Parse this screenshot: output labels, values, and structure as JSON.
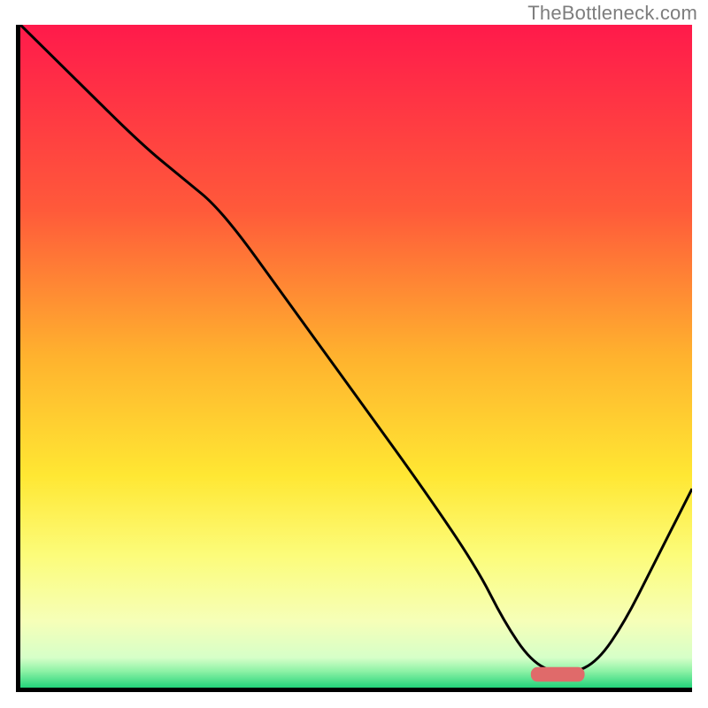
{
  "watermark": {
    "text": "TheBottleneck.com"
  },
  "chart_data": {
    "type": "line",
    "title": "",
    "xlabel": "",
    "ylabel": "",
    "xlim": [
      0,
      100
    ],
    "ylim": [
      0,
      100
    ],
    "gradient_stops": [
      {
        "offset": 0,
        "color": "#ff1a4b"
      },
      {
        "offset": 0.28,
        "color": "#ff5a3a"
      },
      {
        "offset": 0.5,
        "color": "#ffb22e"
      },
      {
        "offset": 0.68,
        "color": "#ffe733"
      },
      {
        "offset": 0.8,
        "color": "#fcfc7a"
      },
      {
        "offset": 0.9,
        "color": "#f6ffb8"
      },
      {
        "offset": 0.955,
        "color": "#d6ffc8"
      },
      {
        "offset": 0.975,
        "color": "#8ef2a6"
      },
      {
        "offset": 1.0,
        "color": "#23d37a"
      }
    ],
    "series": [
      {
        "name": "curve",
        "x": [
          0,
          8,
          18,
          24,
          30,
          40,
          50,
          60,
          68,
          72,
          76,
          80,
          82,
          86,
          90,
          94,
          100
        ],
        "y": [
          100,
          92,
          82,
          77,
          72,
          58,
          44,
          30,
          18,
          10,
          4,
          2,
          2,
          4,
          10,
          18,
          30
        ]
      }
    ],
    "marker": {
      "name": "optimum-marker",
      "x_center": 80,
      "y": 2,
      "width": 8,
      "height": 2.2,
      "color": "#e06a6a"
    }
  }
}
